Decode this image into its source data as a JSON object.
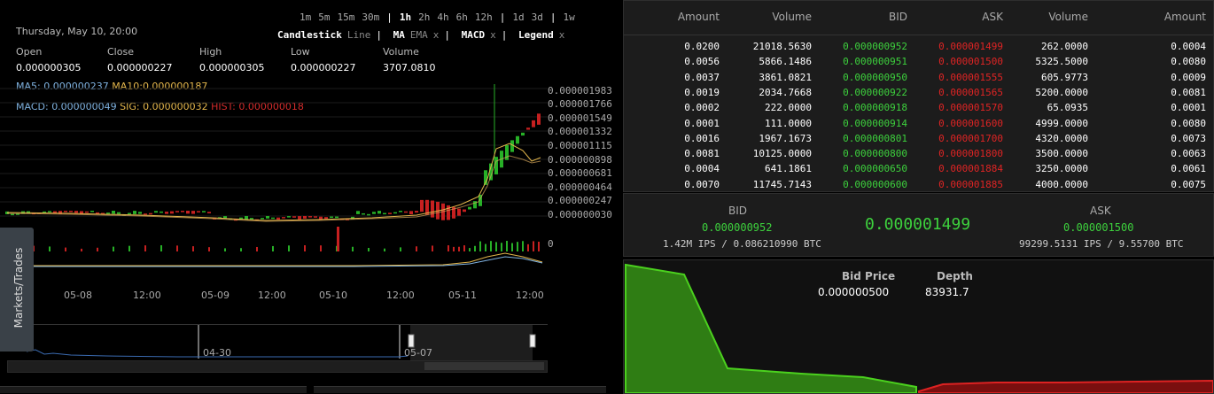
{
  "chart": {
    "datetime": "Thursday, May 10, 20:00",
    "timeframes": [
      "1m",
      "5m",
      "15m",
      "30m",
      "1h",
      "2h",
      "4h",
      "6h",
      "12h",
      "1d",
      "3d",
      "1w"
    ],
    "selected_timeframe": "1h",
    "tools": {
      "candlestick": "Candlestick",
      "line": "Line",
      "ma": "MA",
      "ema": "EMA",
      "x1": "x",
      "macd": "MACD",
      "x2": "x",
      "legend": "Legend",
      "x3": "x"
    },
    "ohlc": {
      "open_label": "Open",
      "open": "0.000000305",
      "close_label": "Close",
      "close": "0.000000227",
      "high_label": "High",
      "high": "0.000000305",
      "low_label": "Low",
      "low": "0.000000227",
      "volume_label": "Volume",
      "volume": "3707.0810"
    },
    "ma5_label": "MA5:",
    "ma5": "0.000000237",
    "ma10_label": "MA10:",
    "ma10": "0.000000187",
    "macd_label": "MACD:",
    "macd": "0.000000049",
    "sig_label": "SIG:",
    "sig": "0.000000032",
    "hist_label": "HIST:",
    "hist": "0.000000018",
    "y_ticks": [
      "0.000001983",
      "0.000001766",
      "0.000001549",
      "0.000001332",
      "0.000001115",
      "0.000000898",
      "0.000000681",
      "0.000000464",
      "0.000000247",
      "0.000000030"
    ],
    "volume_zero": "0",
    "x_ticks": [
      "05-08",
      "12:00",
      "05-09",
      "12:00",
      "05-10",
      "12:00",
      "05-11",
      "12:00"
    ],
    "navigator_labels": [
      "04-30",
      "05-07"
    ],
    "side_tab": "Markets/Trades"
  },
  "order_book": {
    "headers": [
      "Amount",
      "Volume",
      "BID",
      "ASK",
      "Volume",
      "Amount"
    ],
    "rows": [
      [
        "0.0200",
        "21018.5630",
        "0.000000952",
        "0.000001499",
        "262.0000",
        "0.0004"
      ],
      [
        "0.0056",
        "5866.1486",
        "0.000000951",
        "0.000001500",
        "5325.5000",
        "0.0080"
      ],
      [
        "0.0037",
        "3861.0821",
        "0.000000950",
        "0.000001555",
        "605.9773",
        "0.0009"
      ],
      [
        "0.0019",
        "2034.7668",
        "0.000000922",
        "0.000001565",
        "5200.0000",
        "0.0081"
      ],
      [
        "0.0002",
        "222.0000",
        "0.000000918",
        "0.000001570",
        "65.0935",
        "0.0001"
      ],
      [
        "0.0001",
        "111.0000",
        "0.000000914",
        "0.000001600",
        "4999.0000",
        "0.0080"
      ],
      [
        "0.0016",
        "1967.1673",
        "0.000000801",
        "0.000001700",
        "4320.0000",
        "0.0073"
      ],
      [
        "0.0081",
        "10125.0000",
        "0.000000800",
        "0.000001800",
        "3500.0000",
        "0.0063"
      ],
      [
        "0.0004",
        "641.1861",
        "0.000000650",
        "0.000001884",
        "3250.0000",
        "0.0061"
      ],
      [
        "0.0070",
        "11745.7143",
        "0.000000600",
        "0.000001885",
        "4000.0000",
        "0.0075"
      ]
    ]
  },
  "ticker": {
    "bid_label": "BID",
    "bid": "0.000000952",
    "last": "0.000001499",
    "ask_label": "ASK",
    "ask": "0.000001500",
    "bid_ips": "1.42M",
    "bid_ips_unit": "IPS / 0.",
    "bid_btc": "086210990",
    "bid_btc_unit": "BTC",
    "ask_ips": "99299.5131",
    "ask_ips_unit": "IPS / 9.",
    "ask_btc": "55700",
    "ask_btc_unit": "BTC"
  },
  "depth": {
    "bid_price_label": "Bid Price",
    "depth_label": "Depth",
    "bid_price": "0.000000500",
    "depth": "83931.7"
  },
  "colors": {
    "green": "#3dd13d",
    "red": "#e02424",
    "ma5": "#7fb2e0",
    "ma10": "#e2b54b"
  }
}
